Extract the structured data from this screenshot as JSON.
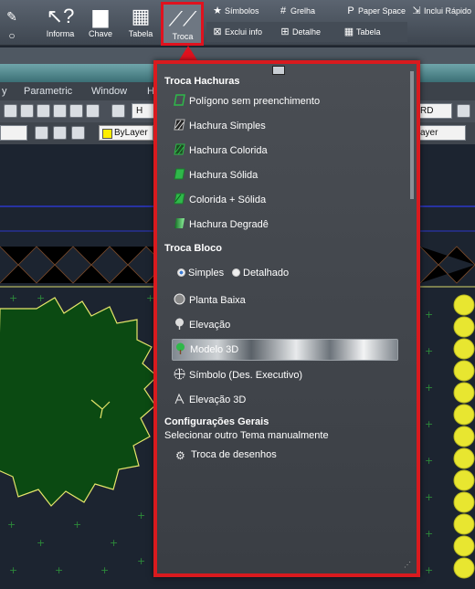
{
  "ribbon": {
    "buttons": [
      {
        "label": "Informa",
        "icon": "info-arrow-icon"
      },
      {
        "label": "Chave",
        "icon": "speech-bubble-icon"
      },
      {
        "label": "Tabela",
        "icon": "table-icon"
      },
      {
        "label": "Troca",
        "icon": "swap-pencil-icon"
      }
    ],
    "small": {
      "simbolos": "Símbolos",
      "grelha": "Grelha",
      "paper_space": "Paper Space",
      "inclui_rapido": "Inclui Rápido",
      "exclui_info": "Exclui info",
      "detalhe": "Detalhe",
      "tabela": "Tabela"
    }
  },
  "menubar": {
    "items": [
      "y",
      "Parametric",
      "Window",
      "H"
    ]
  },
  "toolbar": {
    "field_left": "H",
    "field_right": "RD",
    "bylayer": "ByLayer",
    "layer": "ayer"
  },
  "panel": {
    "hachuras_title": "Troca Hachuras",
    "hachuras": [
      "Polígono sem preenchimento",
      "Hachura Simples",
      "Hachura Colorida",
      "Hachura Sólida",
      "Colorida + Sólida",
      "Hachura Degradê"
    ],
    "bloco_title": "Troca Bloco",
    "radio_simples": "Simples",
    "radio_detalhado": "Detalhado",
    "bloco": [
      "Planta Baixa",
      "Elevação",
      "Modelo 3D",
      "Símbolo (Des. Executivo)",
      "Elevação 3D"
    ],
    "config_title": "Configurações Gerais",
    "config_text": "Selecionar outro Tema manualmente",
    "troca_desenhos": "Troca de desenhos"
  },
  "colors": {
    "accent": "#e0121e",
    "hatch_green": "#2fb84a",
    "tree_fill": "#0b4a12",
    "tree_outline": "#e6e66a"
  }
}
